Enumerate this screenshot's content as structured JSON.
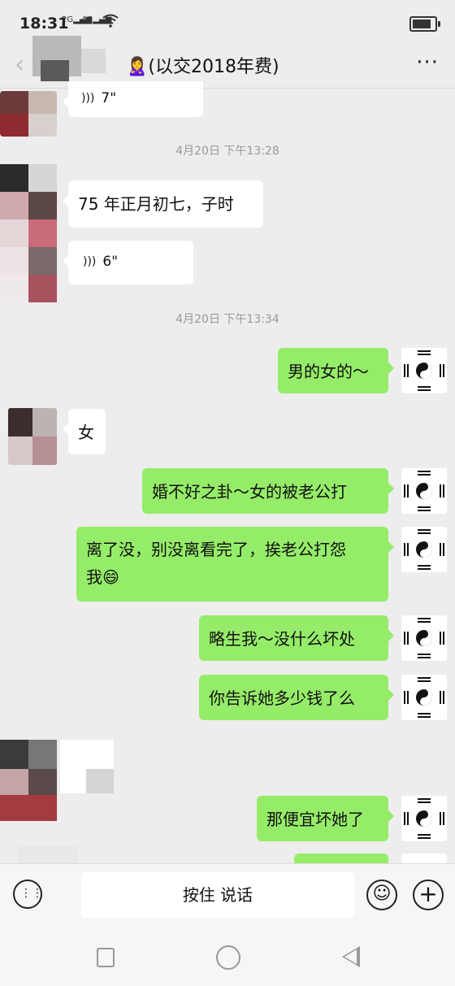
{
  "status_bar": {
    "time": "18:31",
    "signal1": "2G",
    "signal2": "4G"
  },
  "header": {
    "back_glyph": "‹",
    "title": "🙎‍♀️(以交2018年费)",
    "more": "···"
  },
  "messages": [
    {
      "side": "left",
      "kind": "voice",
      "duration": "7\""
    },
    {
      "kind": "timestamp",
      "text": "4月20日 下午13:28"
    },
    {
      "side": "left",
      "kind": "text",
      "text": "75 年正月初七，子时"
    },
    {
      "side": "left",
      "kind": "voice",
      "duration": "6\""
    },
    {
      "kind": "timestamp",
      "text": "4月20日 下午13:34"
    },
    {
      "side": "right",
      "kind": "text",
      "text": "男的女的～"
    },
    {
      "side": "left",
      "kind": "text",
      "text": "女"
    },
    {
      "side": "right",
      "kind": "text",
      "text": "婚不好之卦～女的被老公打"
    },
    {
      "side": "right",
      "kind": "text",
      "text": "离了没，别没离看完了，挨老公打怨"
    },
    {
      "side": "right",
      "kind": "text",
      "text": "我😄"
    },
    {
      "side": "right",
      "kind": "text",
      "text": "略生我～没什么坏处"
    },
    {
      "side": "right",
      "kind": "text",
      "text": "你告诉她多少钱了么"
    },
    {
      "side": "right",
      "kind": "text",
      "text": "那便宜坏她了"
    }
  ],
  "input_bar": {
    "talk_label": "按住 说话",
    "emoji_glyph": "☺",
    "plus_glyph": "+",
    "keyboard_glyph": "⋮⋮"
  },
  "colors": {
    "background": "#ededed",
    "sent_bubble": "#95ec69",
    "received_bubble": "#ffffff",
    "timestamp": "#999999"
  }
}
